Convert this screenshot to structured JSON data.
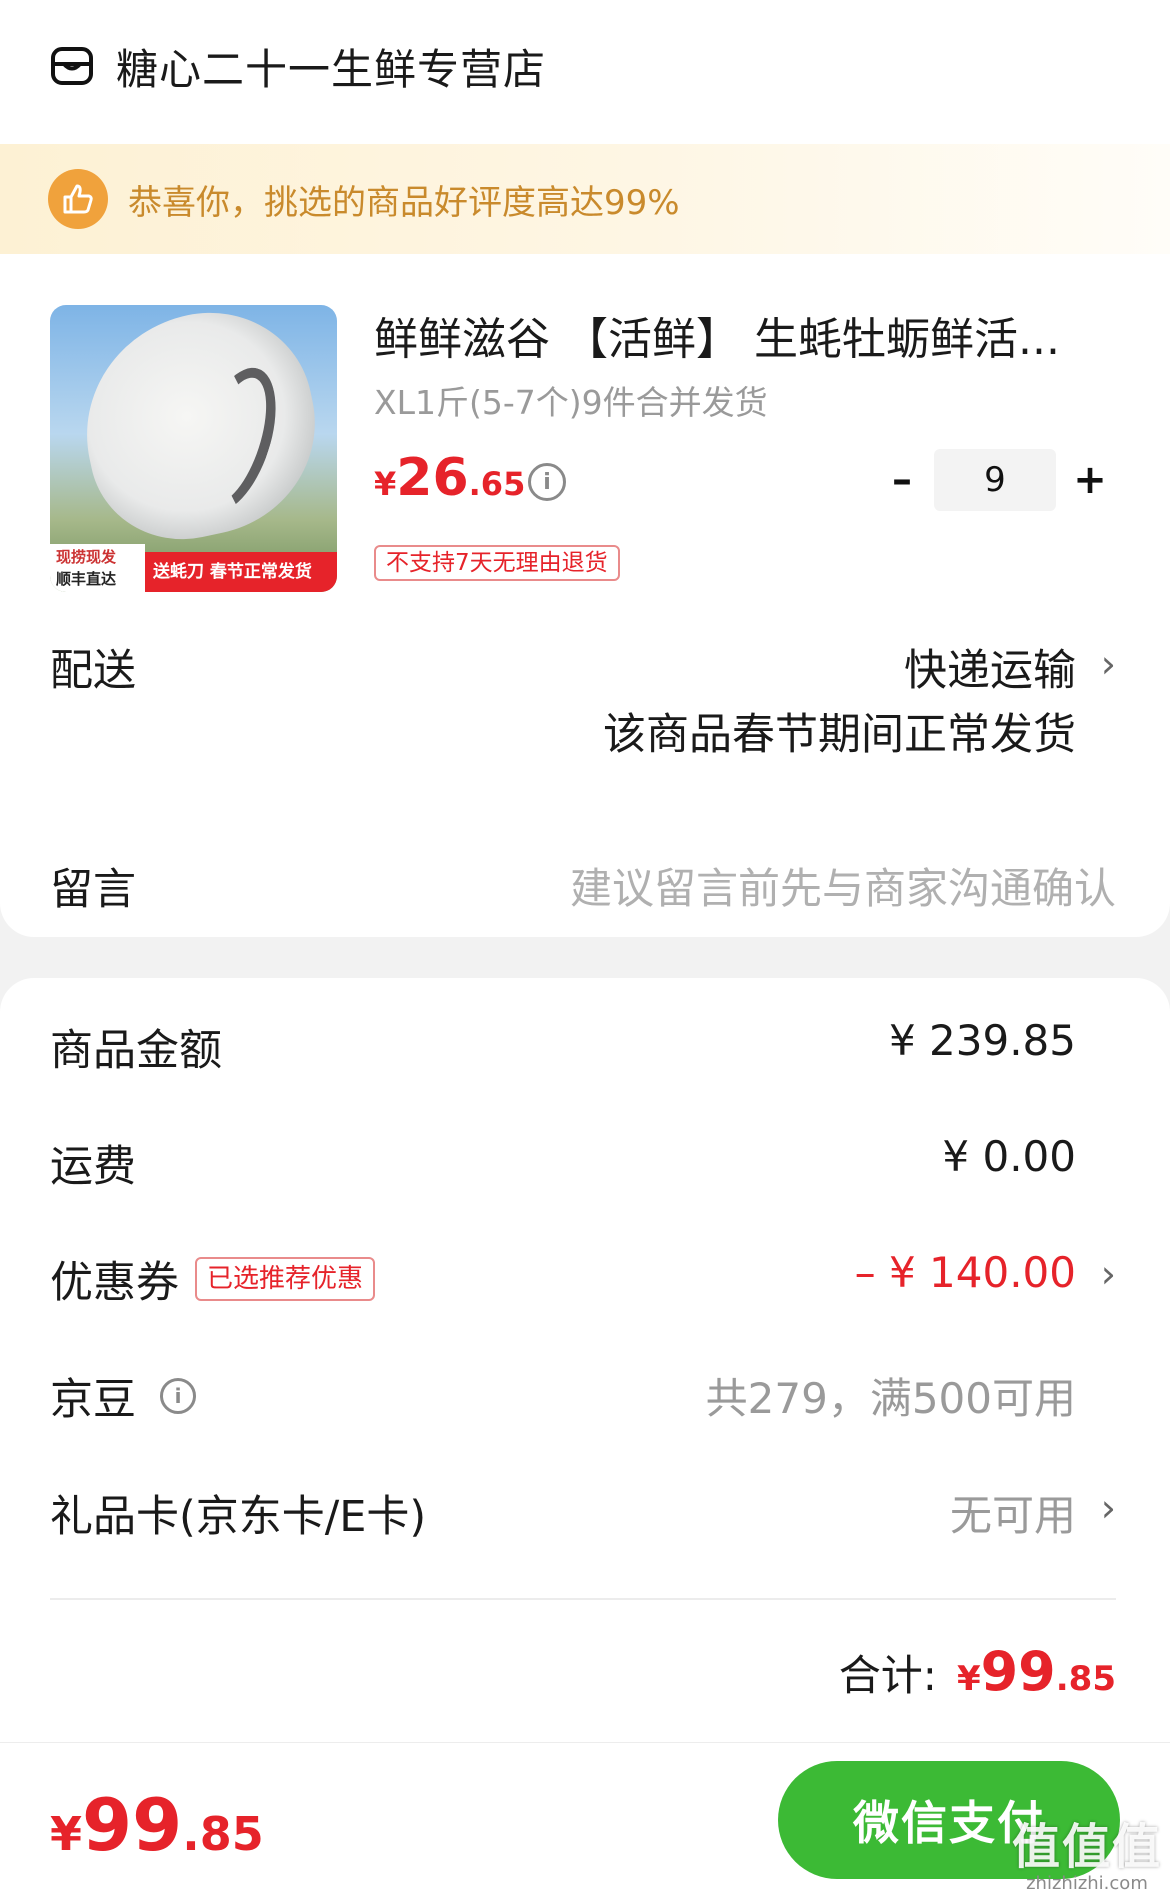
{
  "store": {
    "name": "糖心二十一生鲜专营店"
  },
  "banner": {
    "text": "恭喜你，挑选的商品好评度高达99%"
  },
  "product": {
    "title": "鲜鲜滋谷 【活鲜】 生蚝牡蛎鲜活...",
    "spec": "XL1斤(5-7个)9件合并发货",
    "price_currency": "¥",
    "price_int": "26",
    "price_dec": ".65",
    "quantity": "9",
    "return_tag": "不支持7天无理由退货",
    "image_tag_left_top": "现捞现发",
    "image_tag_left_bottom": "顺丰直达",
    "image_tag_right": "送蚝刀 春节正常发货"
  },
  "delivery": {
    "label": "配送",
    "method": "快递运输",
    "note": "该商品春节期间正常发货"
  },
  "message": {
    "label": "留言",
    "placeholder": "建议留言前先与商家沟通确认"
  },
  "fees": {
    "goods": {
      "label": "商品金额",
      "value": "¥ 239.85"
    },
    "shipping": {
      "label": "运费",
      "value": "¥ 0.00"
    },
    "coupon": {
      "label": "优惠券",
      "tag": "已选推荐优惠",
      "value": "– ¥ 140.00"
    },
    "beans": {
      "label": "京豆",
      "value": "共279，满500可用"
    },
    "giftcard": {
      "label": "礼品卡(京东卡/E卡)",
      "value": "无可用"
    }
  },
  "total": {
    "label": "合计:",
    "currency": "¥",
    "int": "99",
    "dec": ".85"
  },
  "footer": {
    "currency": "¥",
    "int": "99",
    "dec": ".85",
    "pay_label": "微信支付"
  },
  "watermark": {
    "big": "值值值",
    "small": "zhizhizhi.com"
  },
  "colors": {
    "accent_red": "#e6232a",
    "pay_green": "#3cba35",
    "banner_orange": "#f0a23c"
  }
}
